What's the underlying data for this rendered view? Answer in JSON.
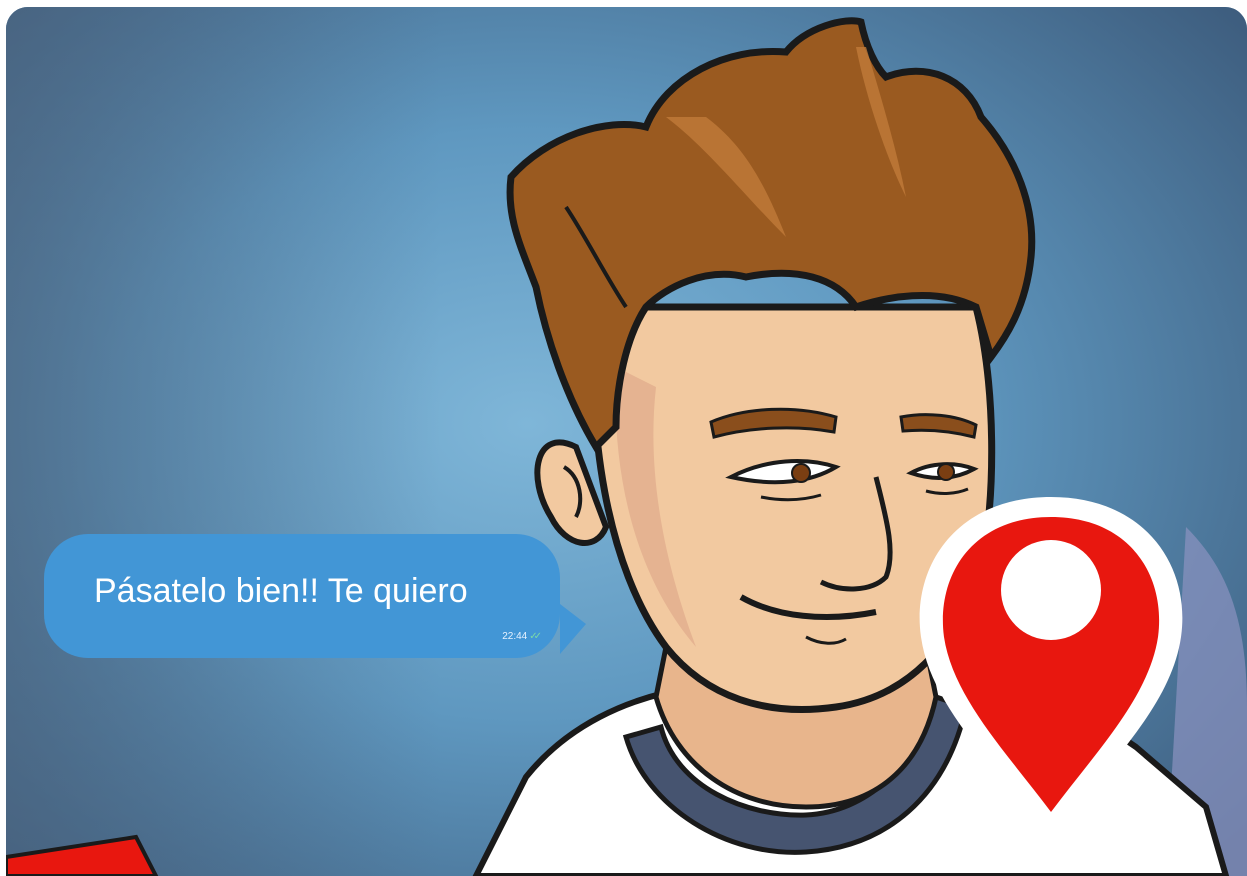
{
  "message": {
    "text": "Pásatelo bien!! Te quiero",
    "time": "22:44",
    "status_icon": "double-check-icon"
  },
  "colors": {
    "bubble": "#4296d6",
    "pin_red": "#e8170f",
    "hair_brown": "#9a5a20",
    "skin": "#f2c9a0",
    "background_blue": "#6aa4c9"
  }
}
